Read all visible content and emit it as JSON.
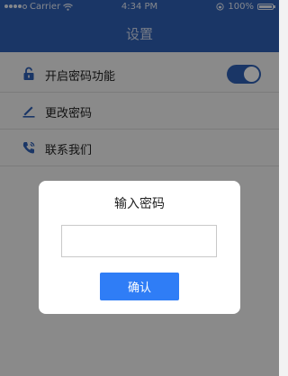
{
  "status_bar": {
    "carrier": "Carrier",
    "time": "4:34 PM",
    "battery": "100%",
    "signal_icon": "signal-dots-icon",
    "wifi_icon": "wifi-icon",
    "lock_icon": "rotation-lock-icon",
    "battery_icon": "battery-icon"
  },
  "navbar": {
    "title": "设置"
  },
  "settings": {
    "items": [
      {
        "label": "开启密码功能",
        "icon": "unlock-icon",
        "toggle_on": true
      },
      {
        "label": "更改密码",
        "icon": "pencil-icon"
      },
      {
        "label": "联系我们",
        "icon": "phone-icon"
      }
    ]
  },
  "dialog": {
    "title": "输入密码",
    "input_value": "",
    "input_placeholder": "",
    "confirm_label": "确认"
  },
  "colors": {
    "primary": "#2f5fb3",
    "button": "#2f7df6",
    "overlay": "rgba(0,0,0,0.43)"
  }
}
